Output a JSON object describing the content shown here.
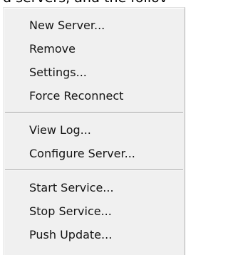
{
  "background_text": "d servers, and the follov",
  "menu": {
    "items": [
      {
        "label": "New Server..."
      },
      {
        "label": "Remove"
      },
      {
        "label": "Settings..."
      },
      {
        "label": "Force Reconnect"
      },
      {
        "label": "View Log..."
      },
      {
        "label": "Configure Server..."
      },
      {
        "label": "Start Service..."
      },
      {
        "label": "Stop Service..."
      },
      {
        "label": "Push Update..."
      }
    ]
  }
}
